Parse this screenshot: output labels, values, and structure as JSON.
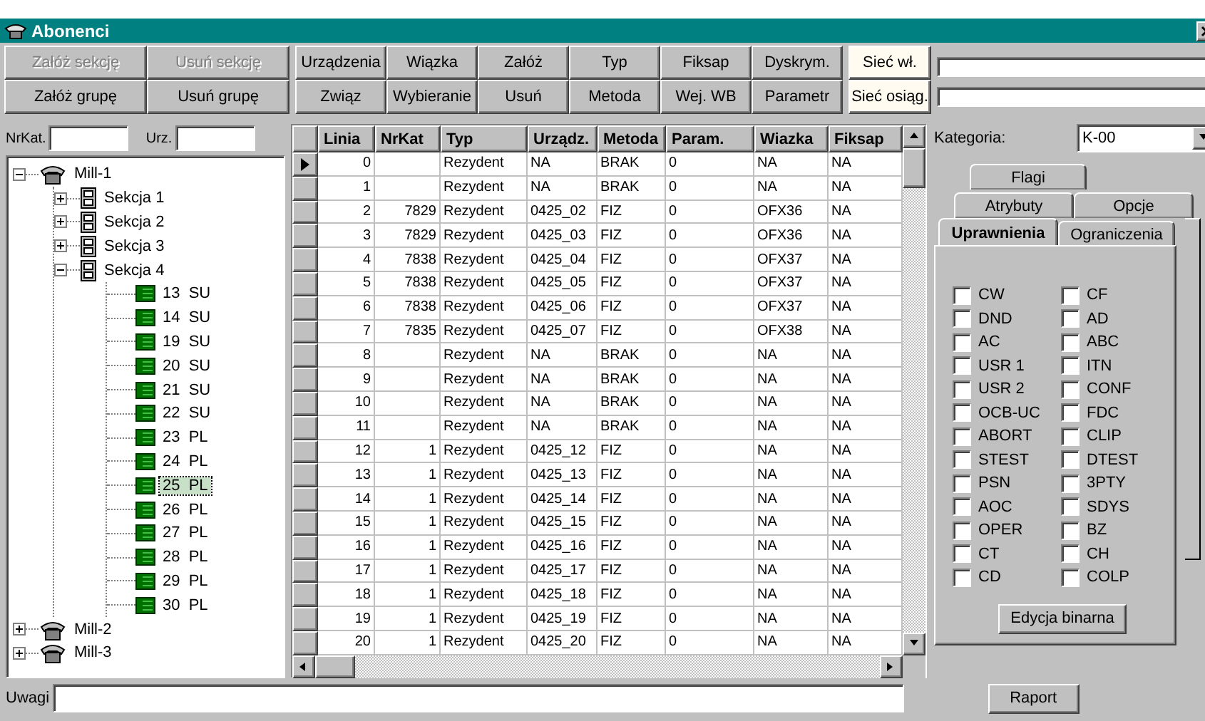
{
  "window": {
    "title": "Abonenci"
  },
  "toolbar": {
    "group_buttons": [
      {
        "label": "Załóż sekcję",
        "disabled": true
      },
      {
        "label": "Usuń sekcję",
        "disabled": true
      },
      {
        "label": "Załóż grupę",
        "disabled": false
      },
      {
        "label": "Usuń grupę",
        "disabled": false
      }
    ],
    "action_buttons": [
      {
        "label": "Urządzenia"
      },
      {
        "label": "Wiązka"
      },
      {
        "label": "Załóż"
      },
      {
        "label": "Typ"
      },
      {
        "label": "Fiksap"
      },
      {
        "label": "Dyskrym."
      },
      {
        "label": "Związ"
      },
      {
        "label": "Wybieranie"
      },
      {
        "label": "Usuń"
      },
      {
        "label": "Metoda"
      },
      {
        "label": "Wej. WB"
      },
      {
        "label": "Parametr"
      }
    ],
    "network_buttons": [
      {
        "label": "Sieć wł."
      },
      {
        "label": "Sieć osiąg."
      }
    ]
  },
  "filters": [
    {
      "label": "NrKat."
    },
    {
      "label": "Urz."
    }
  ],
  "tree": [
    {
      "label": "Mill-1",
      "kind": "exchange",
      "expanded": true,
      "selected": false,
      "children": [
        {
          "label": "Sekcja 1",
          "kind": "section",
          "expanded": false,
          "selected": false
        },
        {
          "label": "Sekcja 2",
          "kind": "section",
          "expanded": false,
          "selected": false
        },
        {
          "label": "Sekcja 3",
          "kind": "section",
          "expanded": false,
          "selected": false
        },
        {
          "label": "Sekcja 4",
          "kind": "section",
          "expanded": true,
          "selected": false,
          "children": [
            {
              "label": "13  SU",
              "kind": "card",
              "selected": false
            },
            {
              "label": "14  SU",
              "kind": "card",
              "selected": false
            },
            {
              "label": "19  SU",
              "kind": "card",
              "selected": false
            },
            {
              "label": "20  SU",
              "kind": "card",
              "selected": false
            },
            {
              "label": "21  SU",
              "kind": "card",
              "selected": false
            },
            {
              "label": "22  SU",
              "kind": "card",
              "selected": false
            },
            {
              "label": "23  PL",
              "kind": "card",
              "selected": false
            },
            {
              "label": "24  PL",
              "kind": "card",
              "selected": false
            },
            {
              "label": "25  PL",
              "kind": "card",
              "selected": true
            },
            {
              "label": "26  PL",
              "kind": "card",
              "selected": false
            },
            {
              "label": "27  PL",
              "kind": "card",
              "selected": false
            },
            {
              "label": "28  PL",
              "kind": "card",
              "selected": false
            },
            {
              "label": "29  PL",
              "kind": "card",
              "selected": false
            },
            {
              "label": "30  PL",
              "kind": "card",
              "selected": false
            }
          ]
        }
      ]
    },
    {
      "label": "Mill-2",
      "kind": "exchange",
      "expanded": false,
      "selected": false
    },
    {
      "label": "Mill-3",
      "kind": "exchange",
      "expanded": false,
      "selected": false
    }
  ],
  "table": {
    "columns": [
      "Linia",
      "NrKat",
      "Typ",
      "Urządz.",
      "Metoda",
      "Param.",
      "Wiazka",
      "Fiksap"
    ],
    "rows": [
      {
        "selected": true,
        "cells": [
          "0",
          "",
          "Rezydent",
          "NA",
          "BRAK",
          "0",
          "NA",
          "NA"
        ]
      },
      {
        "selected": false,
        "cells": [
          "1",
          "",
          "Rezydent",
          "NA",
          "BRAK",
          "0",
          "NA",
          "NA"
        ]
      },
      {
        "selected": false,
        "cells": [
          "2",
          "7829",
          "Rezydent",
          "0425_02",
          "FIZ",
          "0",
          "OFX36",
          "NA"
        ]
      },
      {
        "selected": false,
        "cells": [
          "3",
          "7829",
          "Rezydent",
          "0425_03",
          "FIZ",
          "0",
          "OFX36",
          "NA"
        ]
      },
      {
        "selected": false,
        "cells": [
          "4",
          "7838",
          "Rezydent",
          "0425_04",
          "FIZ",
          "0",
          "OFX37",
          "NA"
        ]
      },
      {
        "selected": false,
        "cells": [
          "5",
          "7838",
          "Rezydent",
          "0425_05",
          "FIZ",
          "0",
          "OFX37",
          "NA"
        ]
      },
      {
        "selected": false,
        "cells": [
          "6",
          "7838",
          "Rezydent",
          "0425_06",
          "FIZ",
          "0",
          "OFX37",
          "NA"
        ]
      },
      {
        "selected": false,
        "cells": [
          "7",
          "7835",
          "Rezydent",
          "0425_07",
          "FIZ",
          "0",
          "OFX38",
          "NA"
        ]
      },
      {
        "selected": false,
        "cells": [
          "8",
          "",
          "Rezydent",
          "NA",
          "BRAK",
          "0",
          "NA",
          "NA"
        ]
      },
      {
        "selected": false,
        "cells": [
          "9",
          "",
          "Rezydent",
          "NA",
          "BRAK",
          "0",
          "NA",
          "NA"
        ]
      },
      {
        "selected": false,
        "cells": [
          "10",
          "",
          "Rezydent",
          "NA",
          "BRAK",
          "0",
          "NA",
          "NA"
        ]
      },
      {
        "selected": false,
        "cells": [
          "11",
          "",
          "Rezydent",
          "NA",
          "BRAK",
          "0",
          "NA",
          "NA"
        ]
      },
      {
        "selected": false,
        "cells": [
          "12",
          "1",
          "Rezydent",
          "0425_12",
          "FIZ",
          "0",
          "NA",
          "NA"
        ]
      },
      {
        "selected": false,
        "cells": [
          "13",
          "1",
          "Rezydent",
          "0425_13",
          "FIZ",
          "0",
          "NA",
          "NA"
        ]
      },
      {
        "selected": false,
        "cells": [
          "14",
          "1",
          "Rezydent",
          "0425_14",
          "FIZ",
          "0",
          "NA",
          "NA"
        ]
      },
      {
        "selected": false,
        "cells": [
          "15",
          "1",
          "Rezydent",
          "0425_15",
          "FIZ",
          "0",
          "NA",
          "NA"
        ]
      },
      {
        "selected": false,
        "cells": [
          "16",
          "1",
          "Rezydent",
          "0425_16",
          "FIZ",
          "0",
          "NA",
          "NA"
        ]
      },
      {
        "selected": false,
        "cells": [
          "17",
          "1",
          "Rezydent",
          "0425_17",
          "FIZ",
          "0",
          "NA",
          "NA"
        ]
      },
      {
        "selected": false,
        "cells": [
          "18",
          "1",
          "Rezydent",
          "0425_18",
          "FIZ",
          "0",
          "NA",
          "NA"
        ]
      },
      {
        "selected": false,
        "cells": [
          "19",
          "1",
          "Rezydent",
          "0425_19",
          "FIZ",
          "0",
          "NA",
          "NA"
        ]
      },
      {
        "selected": false,
        "cells": [
          "20",
          "1",
          "Rezydent",
          "0425_20",
          "FIZ",
          "0",
          "NA",
          "NA"
        ]
      }
    ]
  },
  "category": {
    "label": "Kategoria:",
    "value": "K-00"
  },
  "tab_rows": [
    {
      "tabs": [
        {
          "label": "Flagi",
          "selected": false
        }
      ]
    },
    {
      "tabs": [
        {
          "label": "Atrybuty",
          "selected": false
        },
        {
          "label": "Opcje",
          "selected": false
        }
      ]
    },
    {
      "tabs": [
        {
          "label": "Uprawnienia",
          "selected": true
        },
        {
          "label": "Ograniczenia",
          "selected": false
        }
      ]
    }
  ],
  "permission_columns": [
    {
      "items": [
        {
          "label": "CW",
          "checked": false
        },
        {
          "label": "DND",
          "checked": false
        },
        {
          "label": "AC",
          "checked": false
        },
        {
          "label": "USR 1",
          "checked": false
        },
        {
          "label": "USR 2",
          "checked": false
        },
        {
          "label": "OCB-UC",
          "checked": false
        },
        {
          "label": "ABORT",
          "checked": false
        },
        {
          "label": "STEST",
          "checked": false
        },
        {
          "label": "PSN",
          "checked": false
        },
        {
          "label": "AOC",
          "checked": false
        },
        {
          "label": "OPER",
          "checked": false
        },
        {
          "label": "CT",
          "checked": false
        },
        {
          "label": "CD",
          "checked": false
        }
      ]
    },
    {
      "items": [
        {
          "label": "CF",
          "checked": false
        },
        {
          "label": "AD",
          "checked": false
        },
        {
          "label": "ABC",
          "checked": false
        },
        {
          "label": "ITN",
          "checked": false
        },
        {
          "label": "CONF",
          "checked": false
        },
        {
          "label": "FDC",
          "checked": false
        },
        {
          "label": "CLIP",
          "checked": false
        },
        {
          "label": "DTEST",
          "checked": false
        },
        {
          "label": "3PTY",
          "checked": false
        },
        {
          "label": "SDYS",
          "checked": false
        },
        {
          "label": "BZ",
          "checked": false
        },
        {
          "label": "CH",
          "checked": false
        },
        {
          "label": "COLP",
          "checked": false
        }
      ]
    }
  ],
  "binary_button": {
    "label": "Edycja binarna"
  },
  "notes": {
    "label": "Uwagi"
  },
  "report_button": {
    "label": "Raport"
  }
}
